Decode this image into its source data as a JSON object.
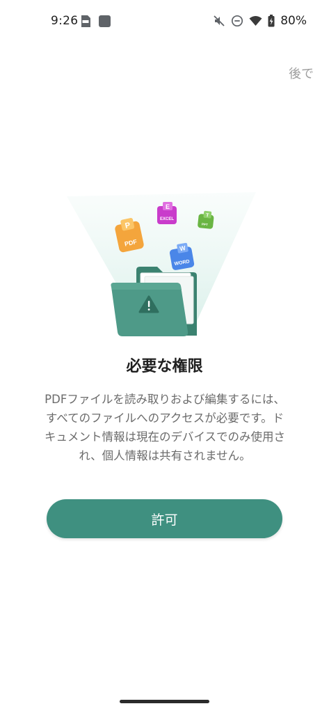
{
  "status_bar": {
    "time": "9:26",
    "battery": "80%",
    "icons": [
      "pdf-notification-icon",
      "app-notification-icon",
      "mute-icon",
      "do-not-disturb-icon",
      "wifi-icon",
      "battery-charging-icon"
    ]
  },
  "header": {
    "later_label": "後で"
  },
  "illustration": {
    "file_labels": {
      "pdf": "PDF",
      "excel": "EXCEL",
      "ppt": "PPT",
      "word": "WORD"
    },
    "file_letters": {
      "pdf": "P",
      "excel": "E",
      "ppt": "T",
      "word": "W"
    },
    "icon": "warning-folder-icon"
  },
  "content": {
    "title": "必要な権限",
    "description": "PDFファイルを読み取りおよび編集するには、すべてのファイルへのアクセスが必要です。ドキュメント情報は現在のデバイスでのみ使用され、個人情報は共有されません。"
  },
  "actions": {
    "allow_label": "許可"
  },
  "colors": {
    "accent": "#3f9080",
    "folder": "#4e9a88",
    "pdf": "#f4a53c",
    "excel": "#c93ccb",
    "ppt": "#6ab543",
    "word": "#4a86e8"
  }
}
